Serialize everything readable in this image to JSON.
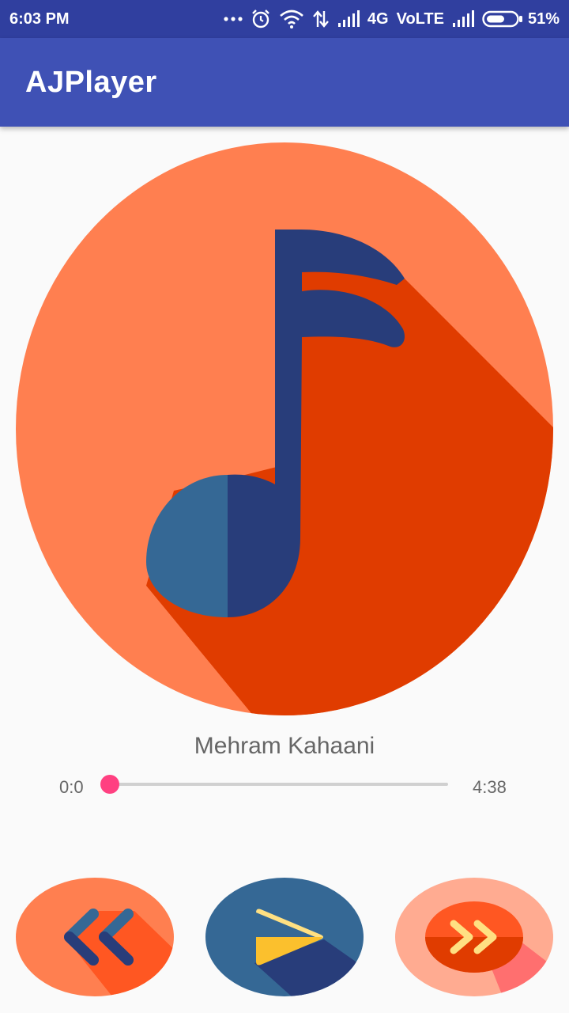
{
  "status_bar": {
    "time": "6:03 PM",
    "network": "4G",
    "volte": "VoLTE",
    "battery": "51%",
    "icons": [
      "more-dots-icon",
      "alarm-icon",
      "wifi-icon",
      "data-arrows-icon",
      "signal-icon",
      "battery-icon"
    ]
  },
  "app_bar": {
    "title": "AJPlayer"
  },
  "player": {
    "song_title": "Mehram Kahaani",
    "current_time": "0:0",
    "total_time": "4:38",
    "progress": 0.0,
    "album_art_icon": "music-note-icon"
  },
  "controls": {
    "previous_icon": "rewind-icon",
    "play_icon": "play-icon",
    "next_icon": "fast-forward-icon"
  },
  "colors": {
    "status_bar": "#303f9f",
    "app_bar": "#3f51b5",
    "accent": "#ff4081",
    "album_bg": "#ff7f50",
    "album_shadow": "#e03c00",
    "note_dark": "#283d7a",
    "note_light": "#356895"
  }
}
